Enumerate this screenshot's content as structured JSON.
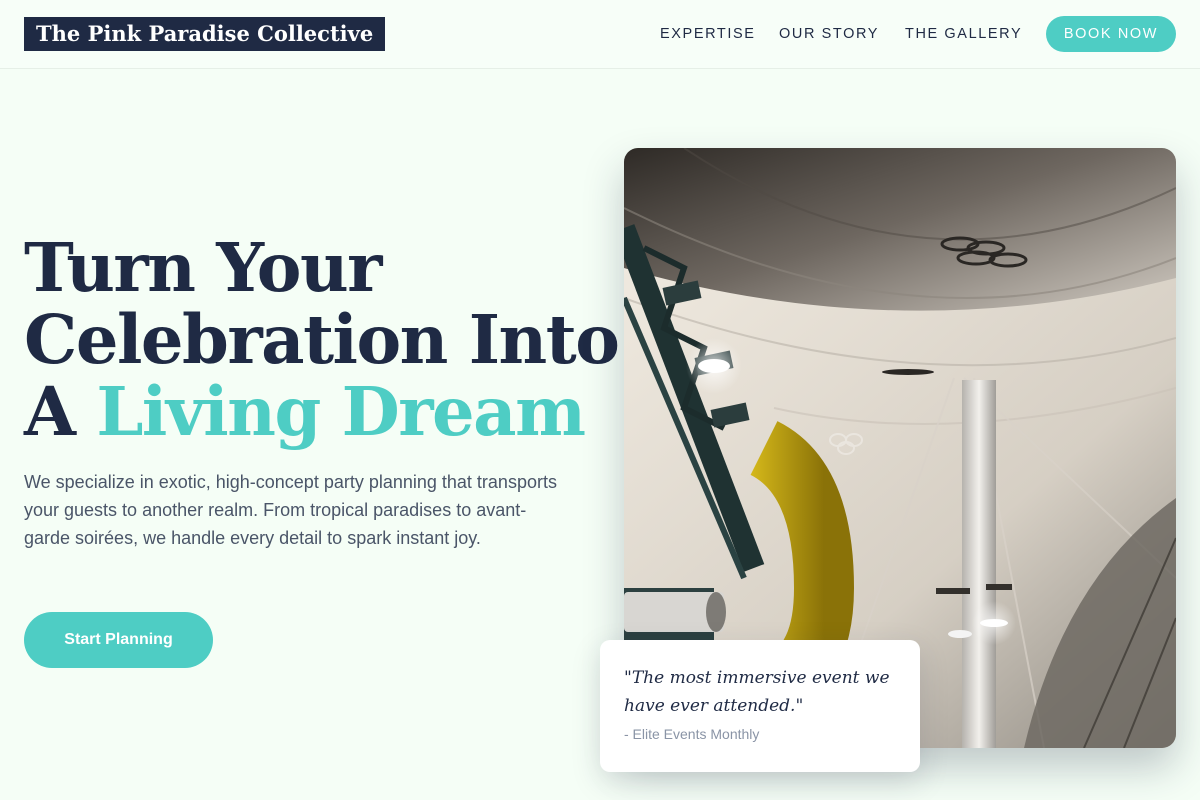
{
  "nav": {
    "logo": "The Pink Paradise Collective",
    "links": [
      "EXPERTISE",
      "OUR STORY",
      "THE GALLERY"
    ],
    "book_label": "BOOK NOW"
  },
  "hero": {
    "headline_line1": "Turn Your",
    "headline_line2": "Celebration Into",
    "headline_line3_plain": "A ",
    "headline_line3_accent": "Living Dream",
    "intro": "We specialize in exotic, high-concept party planning that transports your guests to another realm. From tropical paradises to avant-garde soirées, we handle every detail to spark instant joy.",
    "cta_label": "Start Planning"
  },
  "testimonial": {
    "quote": "\"The most immersive event we have ever attended.\"",
    "source": "- Elite Events Monthly"
  },
  "colors": {
    "accent": "#4ecdc4",
    "navy": "#1f2a44",
    "background": "#f5fef6"
  }
}
